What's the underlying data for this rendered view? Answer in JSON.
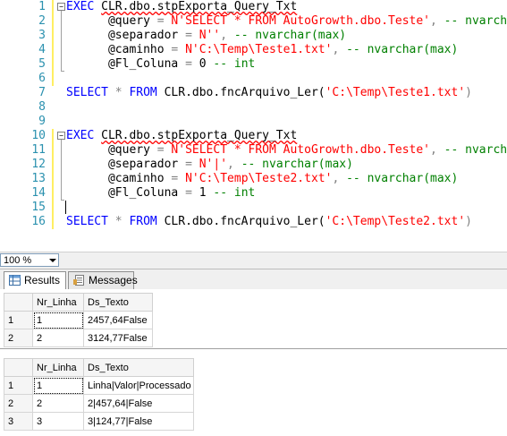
{
  "editor": {
    "line_numbers": [
      "1",
      "2",
      "3",
      "4",
      "5",
      "6",
      "7",
      "8",
      "9",
      "10",
      "11",
      "12",
      "13",
      "14",
      "15",
      "16"
    ],
    "block1": {
      "exec_kw": "EXEC",
      "proc": "CLR.dbo.stpExporta_Query_Txt",
      "p_query": "@query",
      "p_query_val": "N'SELECT * FROM AutoGrowth.dbo.Teste'",
      "p_query_cmt": "-- nvarchar(max)",
      "p_sep": "@separador",
      "p_sep_val": "N''",
      "p_sep_cmt": "-- nvarchar(max)",
      "p_path": "@caminho",
      "p_path_val": "N'C:\\Temp\\Teste1.txt'",
      "p_path_cmt": "-- nvarchar(max)",
      "p_fl": "@Fl_Coluna",
      "p_fl_val": "0",
      "p_fl_cmt": "-- int"
    },
    "select1": {
      "kw": "SELECT",
      "star": "*",
      "from": "FROM",
      "func": "CLR.dbo.fncArquivo_Ler(",
      "arg": "'C:\\Temp\\Teste1.txt'",
      "close": ")"
    },
    "block2": {
      "exec_kw": "EXEC",
      "proc": "CLR.dbo.stpExporta_Query_Txt",
      "p_query": "@query",
      "p_query_val": "N'SELECT * FROM AutoGrowth.dbo.Teste'",
      "p_query_cmt": "-- nvarchar(max)",
      "p_sep": "@separador",
      "p_sep_val": "N'|'",
      "p_sep_cmt": "-- nvarchar(max)",
      "p_path": "@caminho",
      "p_path_val": "N'C:\\Temp\\Teste2.txt'",
      "p_path_cmt": "-- nvarchar(max)",
      "p_fl": "@Fl_Coluna",
      "p_fl_val": "1",
      "p_fl_cmt": "-- int"
    },
    "select2": {
      "kw": "SELECT",
      "star": "*",
      "from": "FROM",
      "func": "CLR.dbo.fncArquivo_Ler(",
      "arg": "'C:\\Temp\\Teste2.txt'",
      "close": ")"
    }
  },
  "zoom": {
    "value": "100 %"
  },
  "tabs": {
    "results": "Results",
    "messages": "Messages"
  },
  "grid1": {
    "headers": [
      "Nr_Linha",
      "Ds_Texto"
    ],
    "rows": [
      {
        "rownum": "1",
        "nr": "1",
        "txt": "2457,64False"
      },
      {
        "rownum": "2",
        "nr": "2",
        "txt": "3124,77False"
      }
    ]
  },
  "grid2": {
    "headers": [
      "Nr_Linha",
      "Ds_Texto"
    ],
    "rows": [
      {
        "rownum": "1",
        "nr": "1",
        "txt": "Linha|Valor|Processado"
      },
      {
        "rownum": "2",
        "nr": "2",
        "txt": "2|457,64|False"
      },
      {
        "rownum": "3",
        "nr": "3",
        "txt": "3|124,77|False"
      }
    ]
  },
  "colors": {
    "keyword": "#0000ff",
    "string": "#ff0000",
    "comment": "#008000",
    "line_number": "#2b91af",
    "operator": "#808080"
  }
}
